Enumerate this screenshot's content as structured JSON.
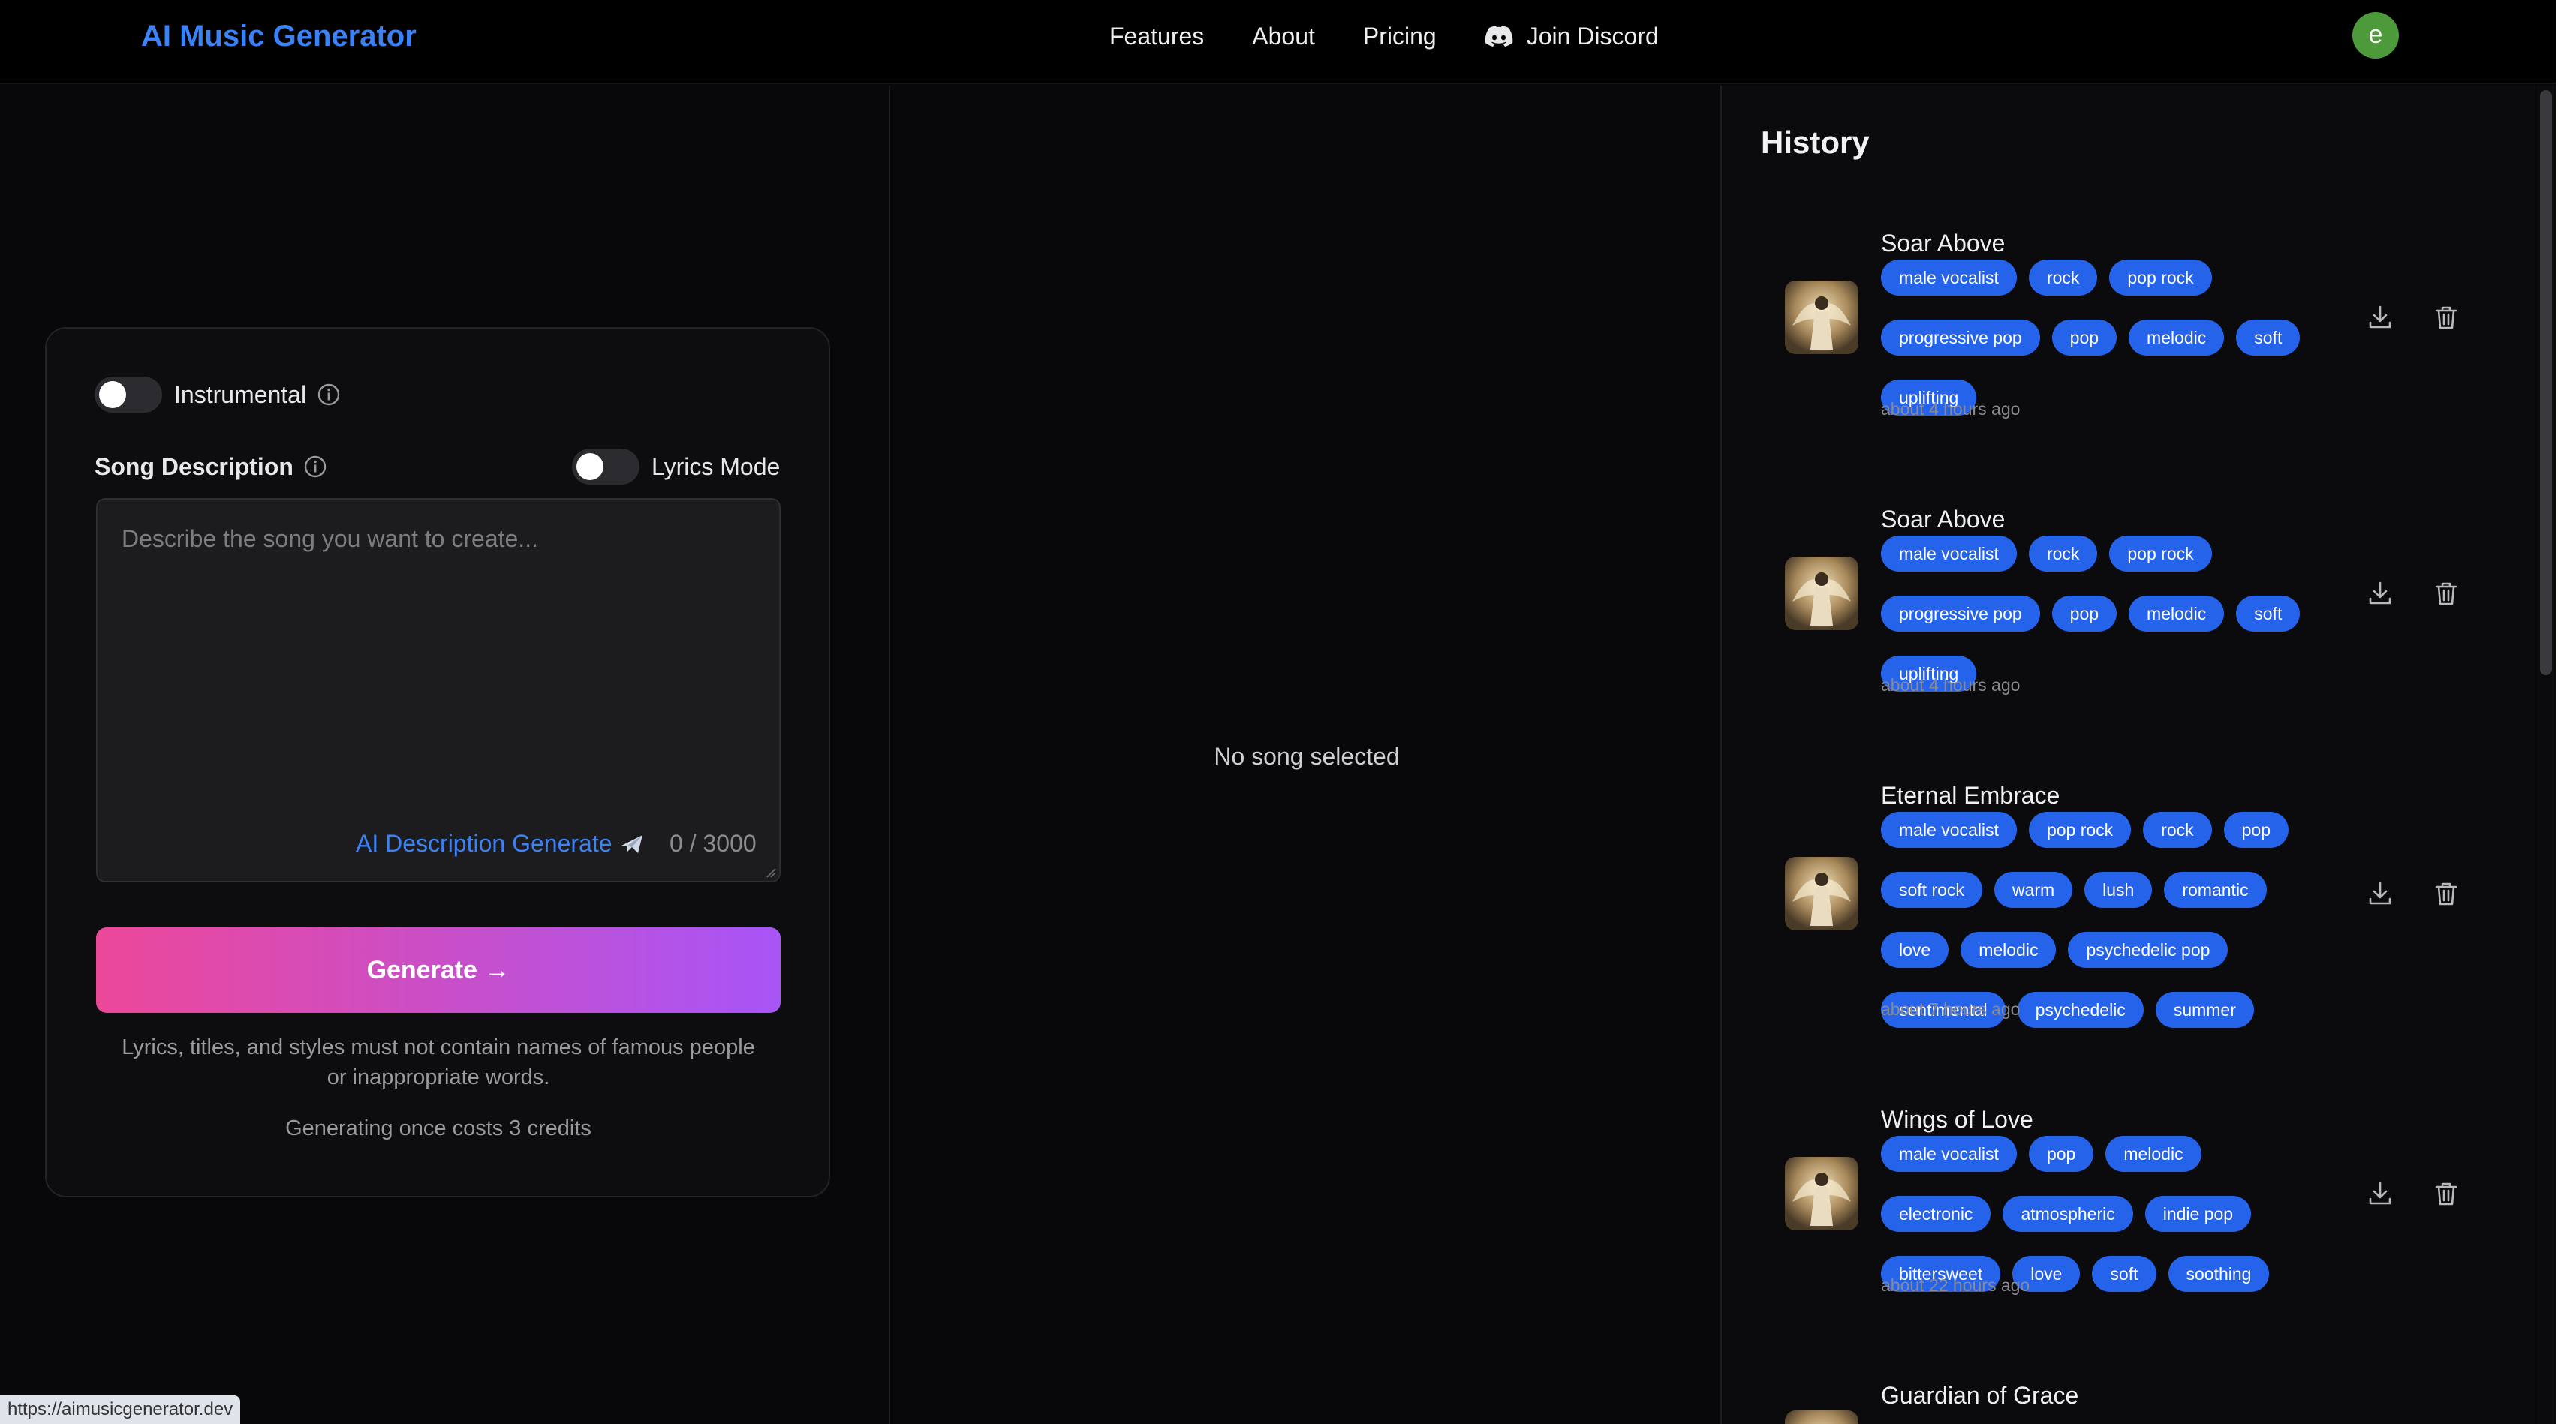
{
  "nav": {
    "brand": "AI Music Generator",
    "links": [
      "Features",
      "About",
      "Pricing"
    ],
    "discord": "Join Discord",
    "avatar_initial": "e",
    "avatar_color": "#4d9a3a"
  },
  "form": {
    "instrumental_label": "Instrumental",
    "song_description_label": "Song Description",
    "lyrics_mode_label": "Lyrics Mode",
    "description_placeholder": "Describe the song you want to create...",
    "ai_generate_label": "AI Description Generate",
    "char_counter": "0 / 3000",
    "generate_button": "Generate →",
    "policy_note": "Lyrics, titles, and styles must not contain names of famous people or inappropriate words.",
    "credits_note": "Generating once costs 3 credits"
  },
  "player": {
    "empty_text": "No song selected"
  },
  "history": {
    "title": "History",
    "items": [
      {
        "title": "Soar Above",
        "tags": [
          "male vocalist",
          "rock",
          "pop rock",
          "progressive pop",
          "pop",
          "melodic",
          "soft",
          "uplifting"
        ],
        "time": "about 4 hours ago"
      },
      {
        "title": "Soar Above",
        "tags": [
          "male vocalist",
          "rock",
          "pop rock",
          "progressive pop",
          "pop",
          "melodic",
          "soft",
          "uplifting"
        ],
        "time": "about 4 hours ago"
      },
      {
        "title": "Eternal Embrace",
        "tags": [
          "male vocalist",
          "pop rock",
          "rock",
          "pop",
          "soft rock",
          "warm",
          "lush",
          "romantic",
          "love",
          "melodic",
          "psychedelic pop",
          "sentimental",
          "psychedelic",
          "summer"
        ],
        "time": "about 7 hours ago"
      },
      {
        "title": "Wings of Love",
        "tags": [
          "male vocalist",
          "pop",
          "melodic",
          "electronic",
          "atmospheric",
          "indie pop",
          "bittersweet",
          "love",
          "soft",
          "soothing"
        ],
        "time": "about 22 hours ago"
      },
      {
        "title": "Guardian of Grace",
        "tags": [],
        "time": ""
      }
    ]
  },
  "status_url": "https://aimusicgenerator.dev",
  "colors": {
    "accent_blue": "#3b82f6",
    "tag_blue": "#2563eb",
    "gradient_start": "#ec4899",
    "gradient_end": "#a855f7"
  }
}
